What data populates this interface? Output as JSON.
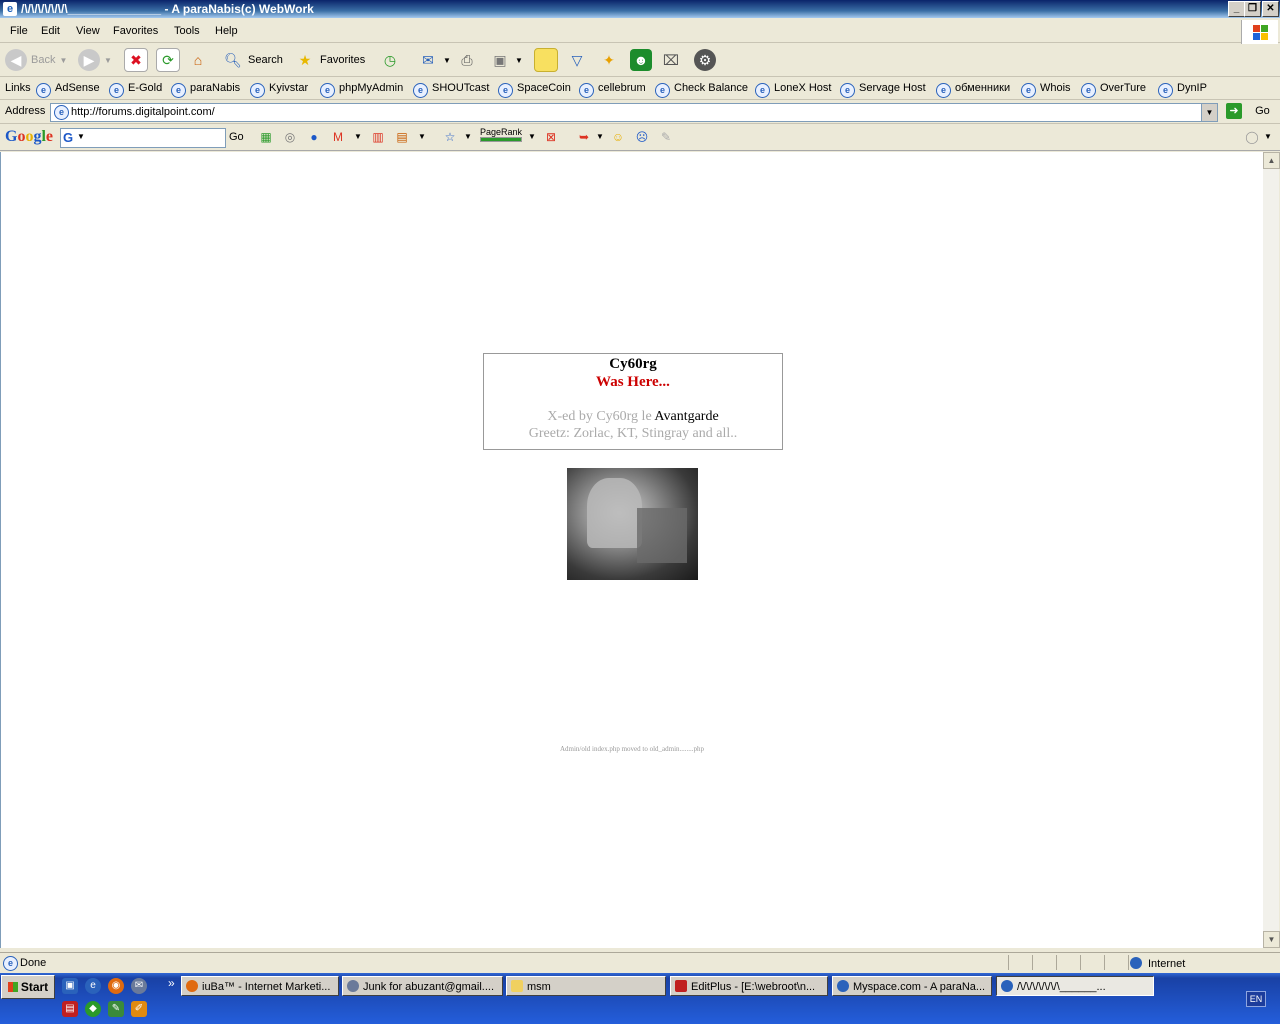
{
  "window": {
    "title": "/\\/\\/\\/\\/\\/\\/\\______________ - A paraNabis(c) WebWork"
  },
  "menu": [
    "File",
    "Edit",
    "View",
    "Favorites",
    "Tools",
    "Help"
  ],
  "toolbar": {
    "back": "Back",
    "search": "Search",
    "favorites": "Favorites"
  },
  "links": {
    "label": "Links",
    "items": [
      "AdSense",
      "E-Gold",
      "paraNabis",
      "Kyivstar",
      "phpMyAdmin",
      "SHOUTcast",
      "SpaceCoin",
      "cellebrum",
      "Check Balance",
      "LoneX Host",
      "Servage Host",
      "обменники",
      "Whois",
      "OverTure",
      "DynIP"
    ]
  },
  "address": {
    "label": "Address",
    "url": "http://forums.digitalpoint.com/",
    "go": "Go"
  },
  "google": {
    "logo": "Google",
    "go": "Go",
    "pagerank": "PageRank"
  },
  "page": {
    "line1": "Cy60rg",
    "line2": "Was Here...",
    "line3_prefix": "X-ed by Cy60rg le",
    "line3_link": "Avantgarde",
    "line4": "Greetz: Zorlac, KT, Stingray and all..",
    "footer": "Admin/old index.php moved to old_admin........php"
  },
  "status": {
    "text": "Done",
    "zone": "Internet"
  },
  "taskbar": {
    "start": "Start",
    "buttons": [
      "iuBa™ - Internet Marketi...",
      "Junk for abuzant@gmail....",
      "msm",
      "EditPlus - [E:\\webroot\\n...",
      "Myspace.com - A paraNa...",
      "/\\/\\/\\/\\/\\/\\/\\______..."
    ],
    "lang": "EN"
  },
  "colors": {
    "title_bg": "#0a246a",
    "accent_red": "#cc0000",
    "taskbar": "#245edb"
  }
}
